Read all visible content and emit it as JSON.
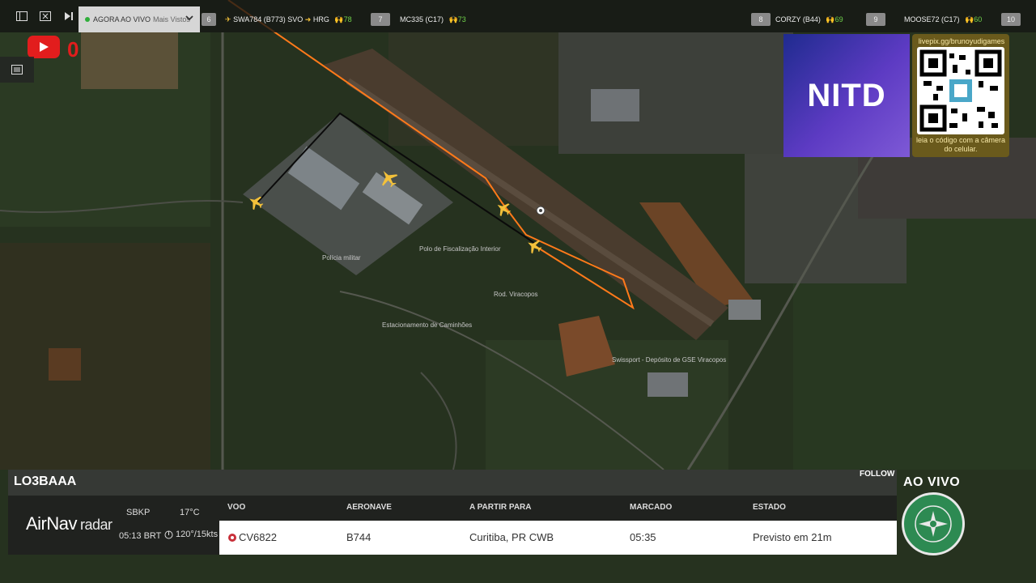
{
  "topbar": {
    "live_selector": {
      "label": "AGORA AO VIVO",
      "sub": "Mais Vistos"
    },
    "ranked_flights": [
      {
        "rank": "6",
        "text": "SWA784 (B773) SVO",
        "dest": "HRG",
        "count": "78"
      },
      {
        "rank": "7",
        "text": "MC335 (C17)",
        "dest": "",
        "count": "73"
      },
      {
        "rank": "8",
        "text": "CORZY (B44)",
        "dest": "",
        "count": "69"
      },
      {
        "rank": "9",
        "text": "MOOSE72 (C17)",
        "dest": "",
        "count": "60"
      },
      {
        "rank": "10",
        "text": "",
        "dest": "",
        "count": ""
      }
    ]
  },
  "overlay": {
    "live_counter": "0",
    "nitd_logo": "NITD",
    "qr_url": "livepix.gg/brunoyudigames",
    "qr_caption": "leia o código com a câmera do celular."
  },
  "map": {
    "labels": [
      "Polícia militar",
      "Polo de Fiscalização Interior",
      "Estacionamento de Caminhões",
      "Swissport - Depósito de GSE Viracopos",
      "Rod. Viracopos"
    ]
  },
  "panel": {
    "registration": "LO3BAAA",
    "follow": "FOLLOW",
    "brand_main": "AirNav",
    "brand_sub": "radar",
    "weather": {
      "icao": "SBKP",
      "time": "05:13 BRT",
      "temp": "17°C",
      "wind": "120°/15kts"
    },
    "columns": {
      "flight": "VOO",
      "aircraft": "AERONAVE",
      "route": "A PARTIR PARA",
      "scheduled": "MARCADO",
      "status": "ESTADO"
    },
    "row": {
      "flight": "CV6822",
      "aircraft": "B744",
      "route": "Curitiba, PR CWB",
      "scheduled": "05:35",
      "status": "Previsto em 21m"
    }
  },
  "badges": {
    "ao_vivo": "AO VIVO"
  },
  "colors": {
    "track": "#ff7a1a",
    "aircraft": "#f3c13a",
    "live_red": "#e21d1d",
    "counter_green": "#6fd14a"
  }
}
